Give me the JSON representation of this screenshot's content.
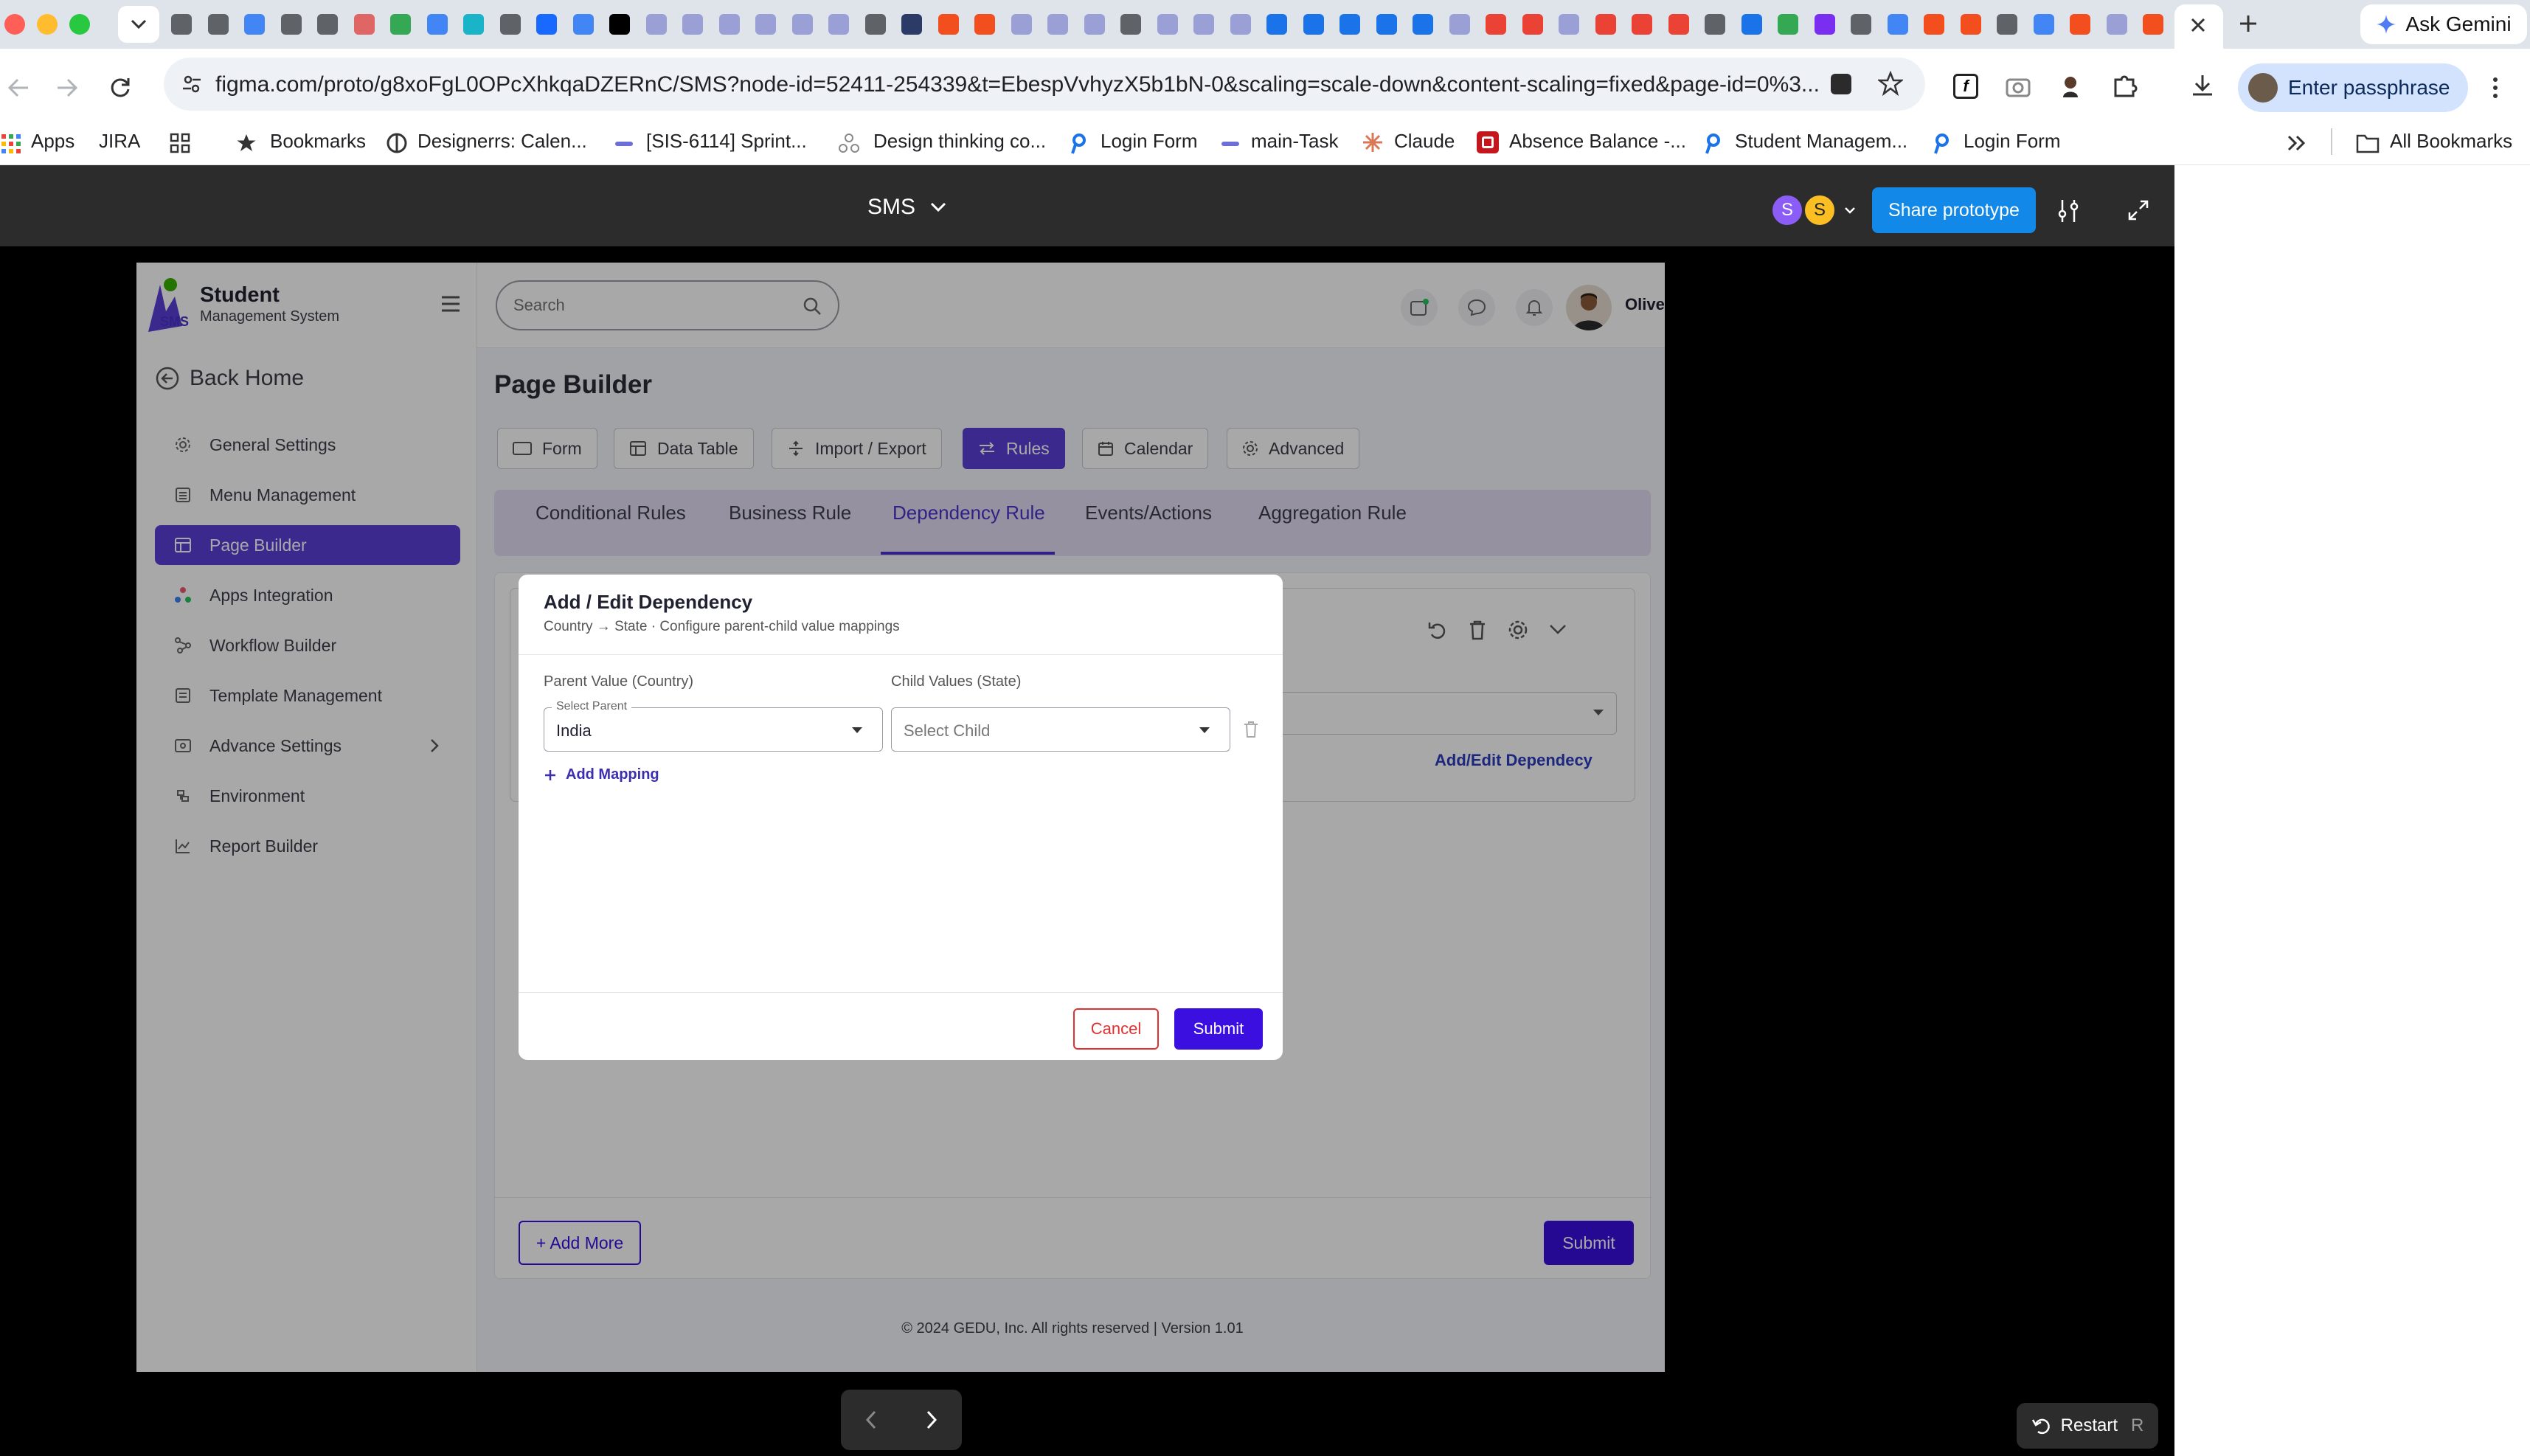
{
  "browser": {
    "url": "figma.com/proto/g8xoFgL0OPcXhkqaDZERnC/SMS?node-id=52411-254339&t=EbespVvhyzX5b1bN-0&scaling=scale-down&content-scaling=fixed&page-id=0%3...",
    "ask_gemini": "Ask Gemini",
    "passphrase": "Enter passphrase",
    "bookmarks": [
      "Apps",
      "JIRA",
      "Bookmarks",
      "Designerrs: Calen...",
      "[SIS-6114] Sprint...",
      "Design thinking co...",
      "Login Form",
      "main-Task",
      "Claude",
      "Absence Balance -...",
      "Student Managem...",
      "Login Form"
    ],
    "all_bookmarks": "All Bookmarks"
  },
  "figma": {
    "file": "SMS",
    "share": "Share prototype",
    "avatars": [
      "S",
      "S"
    ],
    "restart": "Restart",
    "restart_key": "R"
  },
  "app": {
    "brand_title": "Student",
    "brand_sub": "Management System",
    "logo_text": "SMS",
    "back_home": "Back Home",
    "search_placeholder": "Search",
    "user": "Oliver Thompson",
    "nav": [
      "General Settings",
      "Menu Management",
      "Page Builder",
      "Apps Integration",
      "Workflow Builder",
      "Template Management",
      "Advance Settings",
      "Environment",
      "Report Builder"
    ],
    "page_title": "Page Builder",
    "tool_tabs": [
      "Form",
      "Data Table",
      "Import / Export",
      "Rules",
      "Calendar",
      "Advanced"
    ],
    "rule_tabs": [
      "Conditional Rules",
      "Business Rule",
      "Dependency Rule",
      "Events/Actions",
      "Aggregation Rule"
    ],
    "card_link": "Add/Edit Dependecy",
    "add_more": "+ Add More",
    "submit": "Submit",
    "footer": "© 2024 GEDU, Inc. All rights reserved | Version 1.01"
  },
  "modal": {
    "title": "Add / Edit Dependency",
    "subtitle": "Country → State · Configure parent-child value mappings",
    "parent_label": "Parent Value (Country)",
    "child_label": "Child Values (State)",
    "parent_float_label": "Select Parent",
    "parent_value": "India",
    "child_placeholder": "Select Child",
    "add_mapping": "Add Mapping",
    "cancel": "Cancel",
    "submit": "Submit"
  },
  "colors": {
    "primary": "#3b0fe0",
    "active_nav": "#5b3fd6",
    "tab_active": "#4a33c9",
    "tabs_bg": "#e3dcf5",
    "danger": "#e03131",
    "figma_blue": "#1289e8"
  }
}
